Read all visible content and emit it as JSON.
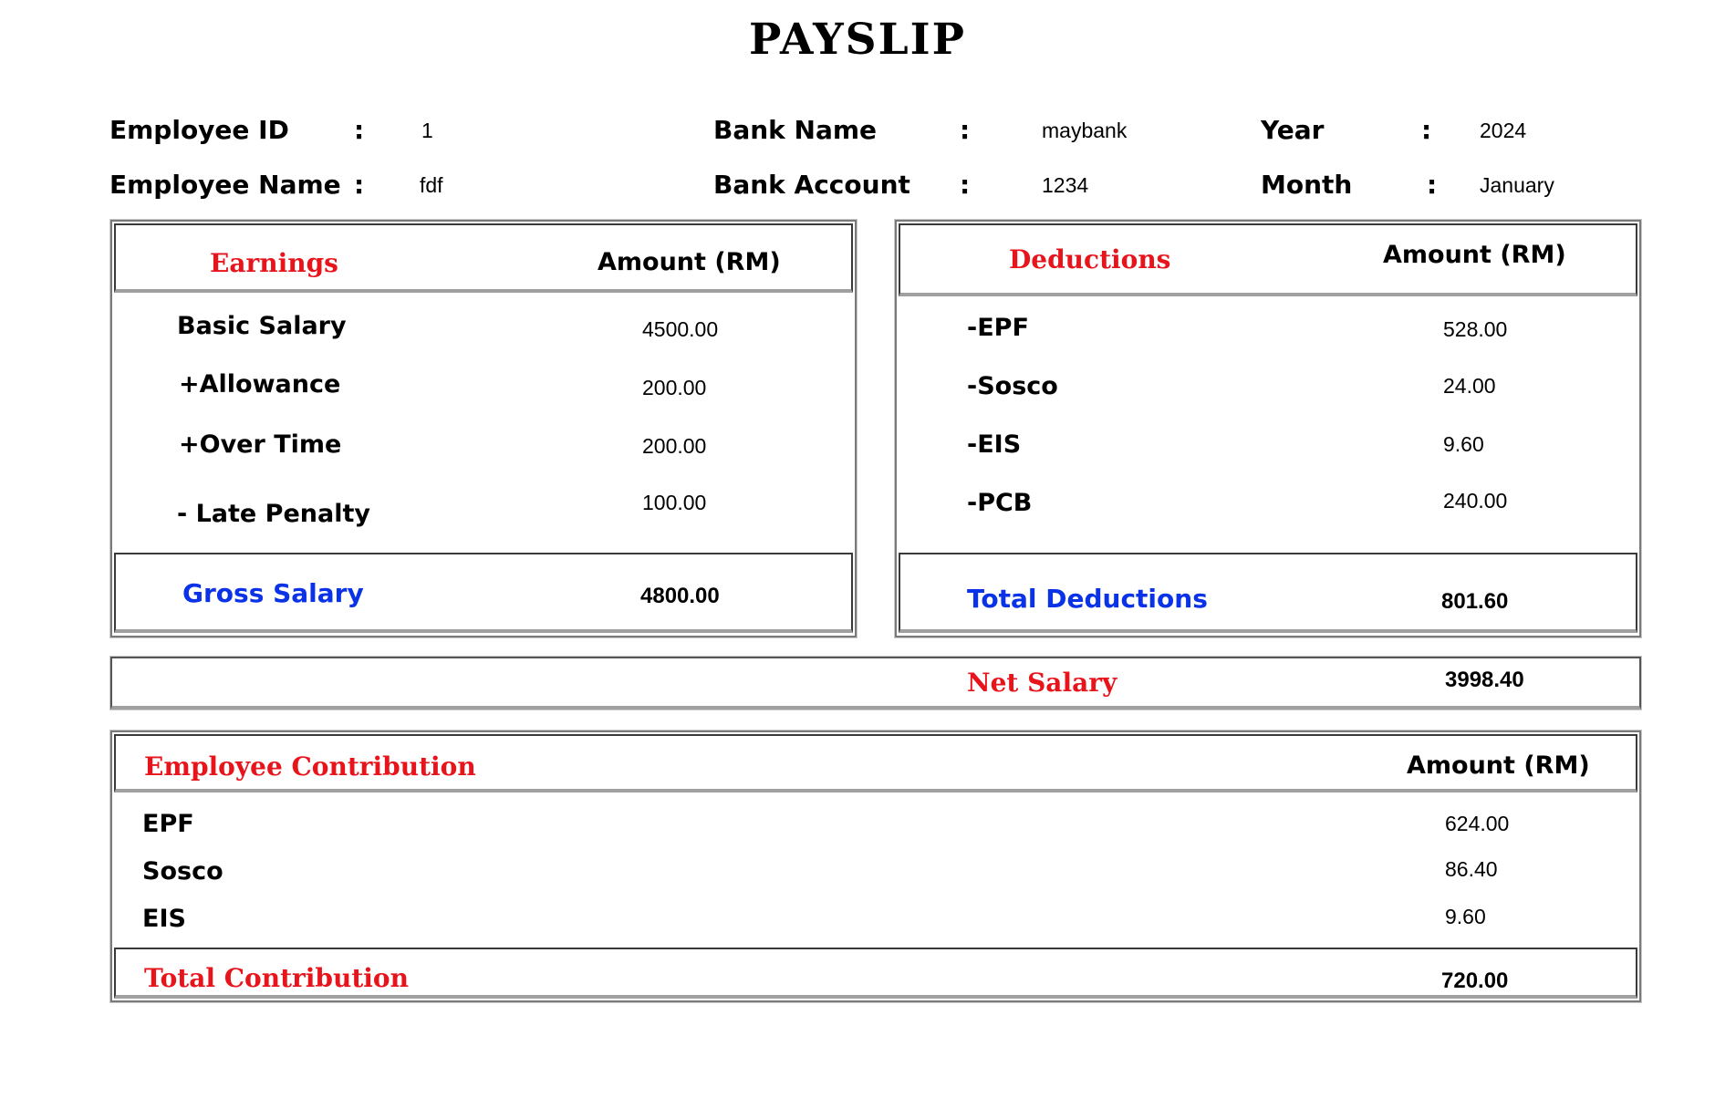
{
  "title": "PAYSLIP",
  "info": {
    "employee_id_label": "Employee ID",
    "employee_id": "1",
    "employee_name_label": "Employee Name",
    "employee_name": "fdf",
    "bank_name_label": "Bank Name",
    "bank_name": "maybank",
    "bank_account_label": "Bank Account",
    "bank_account": "1234",
    "year_label": "Year",
    "year": "2024",
    "month_label": "Month",
    "month": "January",
    "colon": ":"
  },
  "earnings": {
    "header": "Earnings",
    "amount_header": "Amount (RM)",
    "rows": [
      {
        "label": "Basic Salary",
        "value": "4500.00"
      },
      {
        "label": "+Allowance",
        "value": "200.00"
      },
      {
        "label": "+Over Time",
        "value": "200.00"
      },
      {
        "label": "- Late Penalty",
        "value": "100.00"
      }
    ],
    "total_label": "Gross Salary",
    "total_value": "4800.00"
  },
  "deductions": {
    "header": "Deductions",
    "amount_header": "Amount (RM)",
    "rows": [
      {
        "label": "-EPF",
        "value": "528.00"
      },
      {
        "label": "-Sosco",
        "value": "24.00"
      },
      {
        "label": "-EIS",
        "value": "9.60"
      },
      {
        "label": "-PCB",
        "value": "240.00"
      }
    ],
    "total_label": "Total Deductions",
    "total_value": "801.60"
  },
  "net": {
    "label": "Net Salary",
    "value": "3998.40"
  },
  "contribution": {
    "header": "Employee Contribution",
    "amount_header": "Amount (RM)",
    "rows": [
      {
        "label": "EPF",
        "value": "624.00"
      },
      {
        "label": "Sosco",
        "value": "86.40"
      },
      {
        "label": "EIS",
        "value": "9.60"
      }
    ],
    "total_label": "Total Contribution",
    "total_value": "720.00"
  },
  "colors": {
    "accent_red": "#e8141c",
    "accent_blue": "#0a32e6"
  }
}
